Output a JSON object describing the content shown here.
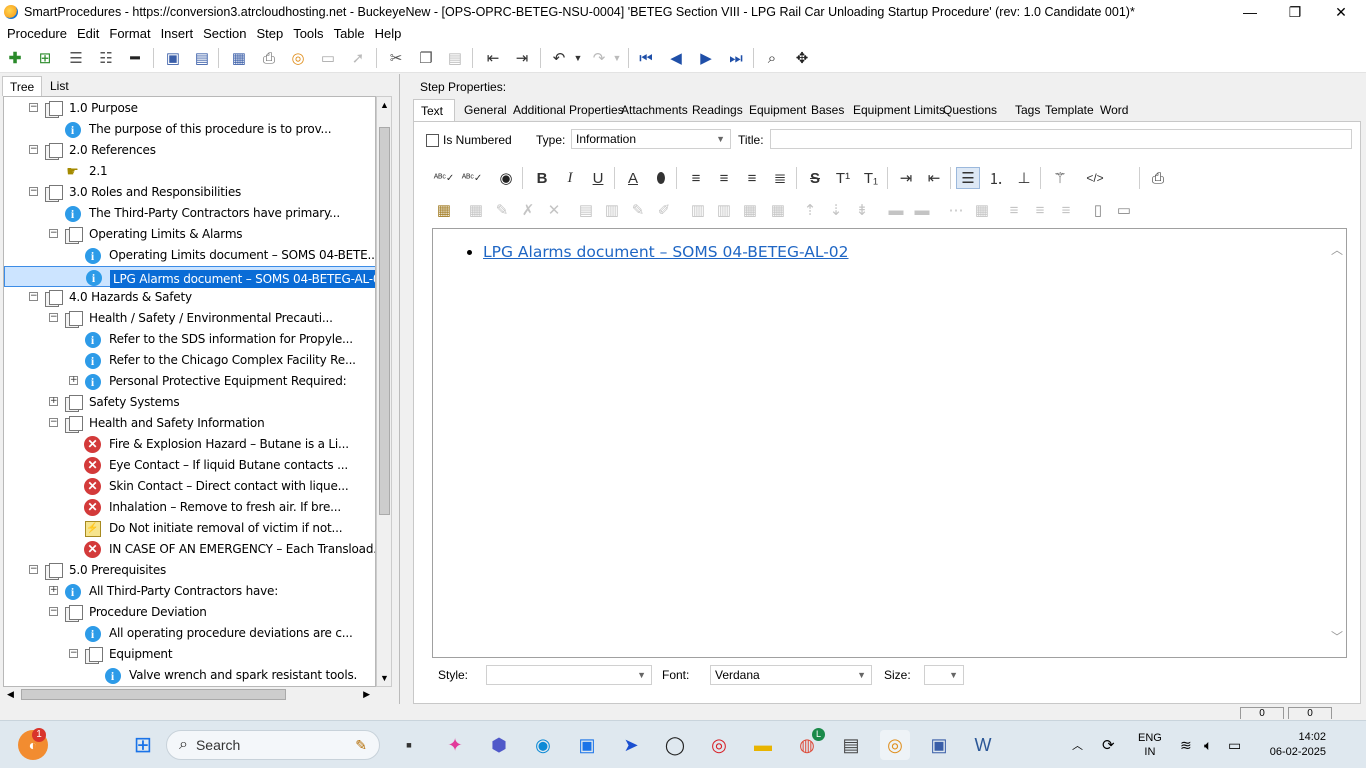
{
  "window": {
    "title": "SmartProcedures - https://conversion3.atrcloudhosting.net - BuckeyeNew - [OPS-OPRC-BETEG-NSU-0004] 'BETEG Section VIII - LPG Rail Car Unloading Startup Procedure' (rev: 1.0 Candidate 001)*",
    "minimize": "—",
    "maximize": "❐",
    "close": "✕"
  },
  "menu": [
    "Procedure",
    "Edit",
    "Format",
    "Insert",
    "Section",
    "Step",
    "Tools",
    "Table",
    "Help"
  ],
  "left_tabs": [
    "Tree",
    "List"
  ],
  "tree": [
    {
      "label": "1.0 Purpose",
      "icon": "folder",
      "level": 0,
      "expander": "−"
    },
    {
      "label": "The purpose of this procedure is to prov...",
      "icon": "info",
      "level": 1,
      "expander": ""
    },
    {
      "label": "2.0 References",
      "icon": "folder",
      "level": 0,
      "expander": "−"
    },
    {
      "label": "2.1",
      "icon": "hand",
      "level": 1,
      "expander": ""
    },
    {
      "label": "3.0 Roles and Responsibilities",
      "icon": "folder",
      "level": 0,
      "expander": "−"
    },
    {
      "label": "The Third-Party Contractors have primary...",
      "icon": "info",
      "level": 1,
      "expander": ""
    },
    {
      "label": "Operating Limits & Alarms",
      "icon": "folder",
      "level": 1,
      "expander": "−"
    },
    {
      "label": "Operating Limits document – SOMS 04-BETE...",
      "icon": "info",
      "level": 2,
      "expander": ""
    },
    {
      "label": "LPG Alarms document – SOMS 04-BETEG-AL-0...",
      "icon": "info",
      "level": 2,
      "expander": "",
      "selected": true
    },
    {
      "label": "4.0 Hazards & Safety",
      "icon": "folder",
      "level": 0,
      "expander": "−"
    },
    {
      "label": "Health / Safety / Environmental Precauti...",
      "icon": "folder",
      "level": 1,
      "expander": "−"
    },
    {
      "label": "Refer to the SDS information for Propyle...",
      "icon": "info",
      "level": 2,
      "expander": ""
    },
    {
      "label": "Refer to the Chicago Complex Facility Re...",
      "icon": "info",
      "level": 2,
      "expander": ""
    },
    {
      "label": "Personal Protective Equipment Required:",
      "icon": "info",
      "level": 2,
      "expander": "+"
    },
    {
      "label": "Safety Systems",
      "icon": "folder",
      "level": 1,
      "expander": "+"
    },
    {
      "label": "Health and Safety Information",
      "icon": "folder",
      "level": 1,
      "expander": "−"
    },
    {
      "label": "Fire & Explosion Hazard – Butane is a Li...",
      "icon": "error",
      "level": 2,
      "expander": ""
    },
    {
      "label": "Eye Contact – If liquid Butane contacts ...",
      "icon": "error",
      "level": 2,
      "expander": ""
    },
    {
      "label": "Skin Contact – Direct contact with lique...",
      "icon": "error",
      "level": 2,
      "expander": ""
    },
    {
      "label": "Inhalation – Remove to fresh air. If bre...",
      "icon": "error",
      "level": 2,
      "expander": ""
    },
    {
      "label": "Do Not initiate removal of victim if not...",
      "icon": "warning",
      "level": 2,
      "expander": ""
    },
    {
      "label": "IN CASE OF AN EMERGENCY – Each Transload...",
      "icon": "error",
      "level": 2,
      "expander": ""
    },
    {
      "label": "5.0 Prerequisites",
      "icon": "folder",
      "level": 0,
      "expander": "−"
    },
    {
      "label": "All Third-Party Contractors have:",
      "icon": "info",
      "level": 1,
      "expander": "+"
    },
    {
      "label": "Procedure Deviation",
      "icon": "folder",
      "level": 1,
      "expander": "−"
    },
    {
      "label": "All operating procedure deviations are c...",
      "icon": "info",
      "level": 2,
      "expander": ""
    },
    {
      "label": "Equipment",
      "icon": "folder",
      "level": 2,
      "expander": "−"
    },
    {
      "label": "Valve wrench and spark resistant tools.",
      "icon": "info",
      "level": 3,
      "expander": ""
    }
  ],
  "step_properties_label": "Step Properties:",
  "prop_tabs": [
    "Text",
    "General",
    "Additional Properties",
    "Attachments",
    "Readings",
    "Equipment",
    "Bases",
    "Equipment Limits",
    "Questions",
    "Tags",
    "Template",
    "Word"
  ],
  "is_numbered_label": "Is Numbered",
  "type_label": "Type:",
  "type_value": "Information",
  "title_label": "Title:",
  "title_value": "",
  "editor_bullet": "LPG Alarms document – SOMS 04-BETEG-AL-02",
  "style_label": "Style:",
  "style_value": "",
  "font_label": "Font:",
  "font_value": "Verdana",
  "size_label": "Size:",
  "size_value": "",
  "status_counts": [
    "0",
    "0"
  ],
  "taskbar": {
    "search_placeholder": "Search",
    "notification_badge": "1",
    "chrome_badge": "L",
    "lang_line1": "ENG",
    "lang_line2": "IN",
    "time": "14:02",
    "date": "06-02-2025"
  },
  "colors": {
    "selection": "#0a6cd6",
    "link": "#1f66c4",
    "info_icon": "#2d9be8",
    "error_icon": "#d33a3a"
  }
}
